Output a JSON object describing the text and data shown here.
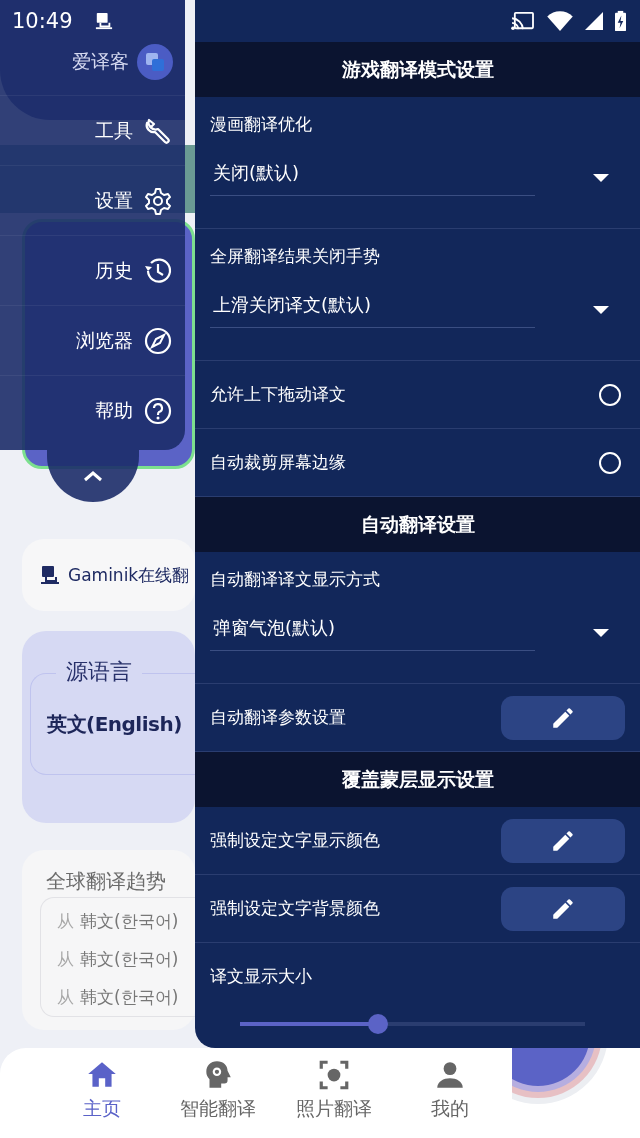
{
  "status_bar": {
    "time": "10:49"
  },
  "page": {
    "online_banner": "Gaminik在线翻",
    "source_language": {
      "label": "源语言",
      "value": "英文(English)"
    },
    "trends": {
      "title": "全球翻译趋势",
      "rows": [
        {
          "from": "从",
          "language": "韩文(한국어)"
        },
        {
          "from": "从",
          "language": "韩文(한국어)"
        },
        {
          "from": "从",
          "language": "韩文(한국어)"
        }
      ]
    }
  },
  "menu": {
    "app_name": "爱译客",
    "items": [
      {
        "label": "工具",
        "kind": "wrench"
      },
      {
        "label": "设置",
        "kind": "gear"
      },
      {
        "label": "历史",
        "kind": "history"
      },
      {
        "label": "浏览器",
        "kind": "compass"
      },
      {
        "label": "帮助",
        "kind": "help"
      }
    ]
  },
  "settings": {
    "sections": [
      {
        "title": "游戏翻译模式设置",
        "rows": [
          {
            "kind": "dropdown",
            "label": "漫画翻译优化",
            "value": "关闭(默认)"
          },
          {
            "kind": "dropdown",
            "label": "全屏翻译结果关闭手势",
            "value": "上滑关闭译文(默认)"
          },
          {
            "kind": "toggle",
            "label": "允许上下拖动译文",
            "on": false
          },
          {
            "kind": "toggle",
            "label": "自动裁剪屏幕边缘",
            "on": false
          }
        ]
      },
      {
        "title": "自动翻译设置",
        "rows": [
          {
            "kind": "dropdown",
            "label": "自动翻译译文显示方式",
            "value": "弹窗气泡(默认)"
          },
          {
            "kind": "edit",
            "label": "自动翻译参数设置"
          }
        ]
      },
      {
        "title": "覆盖蒙层显示设置",
        "rows": [
          {
            "kind": "edit",
            "label": "强制设定文字显示颜色"
          },
          {
            "kind": "edit",
            "label": "强制设定文字背景颜色"
          },
          {
            "kind": "slider",
            "label": "译文显示大小",
            "level": 0.4
          }
        ]
      }
    ]
  },
  "bottom_nav": [
    {
      "label": "主页",
      "kind": "home",
      "selected": true
    },
    {
      "label": "智能翻译",
      "kind": "brain",
      "selected": false
    },
    {
      "label": "照片翻译",
      "kind": "scan",
      "selected": false
    },
    {
      "label": "我的",
      "kind": "person",
      "selected": false
    }
  ]
}
